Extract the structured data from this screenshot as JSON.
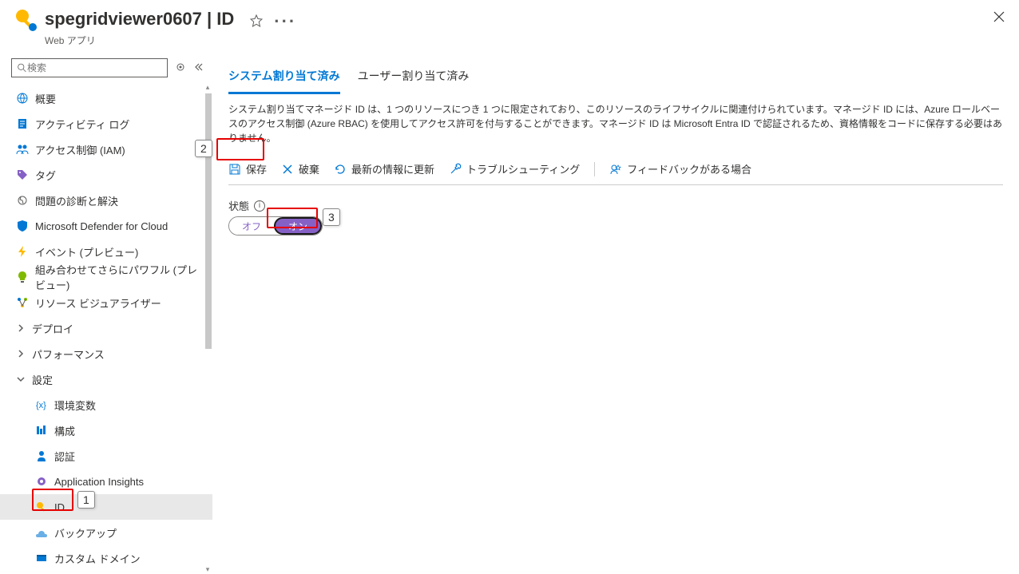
{
  "header": {
    "title": "spegridviewer0607 | ID",
    "subtitle": "Web アプリ"
  },
  "search": {
    "placeholder": "検索"
  },
  "nav": {
    "items": [
      {
        "label": "概要",
        "icon": "globe"
      },
      {
        "label": "アクティビティ ログ",
        "icon": "log"
      },
      {
        "label": "アクセス制御 (IAM)",
        "icon": "iam"
      },
      {
        "label": "タグ",
        "icon": "tag"
      },
      {
        "label": "問題の診断と解決",
        "icon": "diagnose"
      },
      {
        "label": "Microsoft Defender for Cloud",
        "icon": "shield"
      },
      {
        "label": "イベント (プレビュー)",
        "icon": "bolt"
      },
      {
        "label": "組み合わせてさらにパワフル (プレビュー)",
        "icon": "bulb"
      },
      {
        "label": "リソース ビジュアライザー",
        "icon": "resvis"
      },
      {
        "label": "デプロイ",
        "icon": "chev",
        "cat": true
      },
      {
        "label": "パフォーマンス",
        "icon": "chev",
        "cat": true
      },
      {
        "label": "設定",
        "icon": "chev-down",
        "cat": true
      },
      {
        "label": "環境変数",
        "icon": "envvar",
        "sub": true
      },
      {
        "label": "構成",
        "icon": "config",
        "sub": true
      },
      {
        "label": "認証",
        "icon": "auth",
        "sub": true
      },
      {
        "label": "Application Insights",
        "icon": "insights",
        "sub": true
      },
      {
        "label": "ID",
        "icon": "key",
        "sub": true,
        "selected": true
      },
      {
        "label": "バックアップ",
        "icon": "backup",
        "sub": true
      },
      {
        "label": "カスタム ドメイン",
        "icon": "domain",
        "sub": true
      }
    ]
  },
  "tabs": {
    "system": "システム割り当て済み",
    "user": "ユーザー割り当て済み"
  },
  "desc": "システム割り当てマネージド ID は、1 つのリソースにつき 1 つに限定されており、このリソースのライフサイクルに関連付けられています。マネージド ID には、Azure ロールベースのアクセス制御 (Azure RBAC) を使用してアクセス許可を付与することができます。マネージド ID は Microsoft Entra ID で認証されるため、資格情報をコードに保存する必要はありません。",
  "toolbar": {
    "save": "保存",
    "discard": "破棄",
    "refresh": "最新の情報に更新",
    "troubleshoot": "トラブルシューティング",
    "feedback": "フィードバックがある場合"
  },
  "state": {
    "label": "状態",
    "off": "オフ",
    "on": "オン"
  },
  "callouts": {
    "c1": "1",
    "c2": "2",
    "c3": "3"
  }
}
